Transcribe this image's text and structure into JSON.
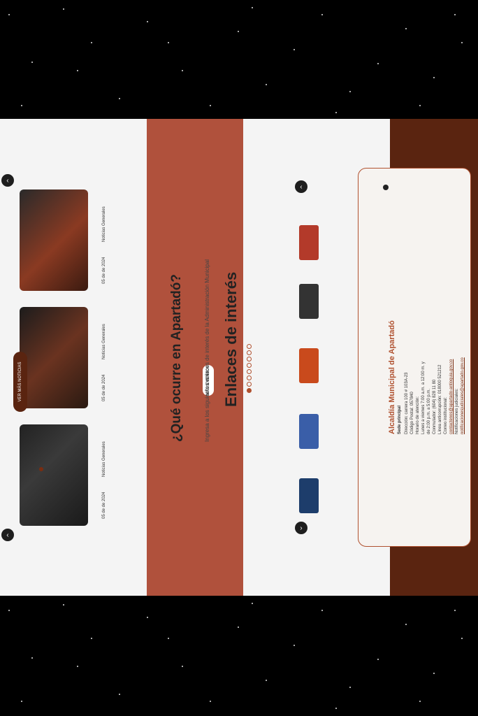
{
  "colors": {
    "brand_dark": "#5a2410",
    "brand_accent": "#b0512f",
    "events_bg": "#b0513c",
    "page_bg": "#f4f4f4"
  },
  "footer": {
    "title": "Alcaldía Municipal de Apartadó",
    "sede_label": "Sede principal",
    "address": "Dirección: carrera 100 # 103A-23",
    "postal": "Código Postal: 057840",
    "hours_label": "Horario de atención:",
    "hours_1": "Lunes a viernes 7:00 a.m. a 12:00 m. y",
    "hours_2": "de 2:00 p.m. a 5:00 p.m.",
    "phone": "Conmutador: (604) 828 11 80",
    "fax": "Línea anticorrupción: 018000 521212",
    "email_label": "Correo institucional:",
    "email": "contactenos@apartado-antioquia.gov.co",
    "notifications": "Notificaciones judiciales:",
    "notif_email": "notificacionesjudiciales@apartado.gov.co"
  },
  "enlaces": {
    "title": "Enlaces de interés",
    "subtitle": "Ingresa a los siguientes enlaces de interés de la Administración Municipal",
    "logos": [
      "gobierno-digital-logo",
      "sigep-logo",
      "transparencia-logo",
      "mintic-logo",
      "secop-logo"
    ],
    "prev": "‹",
    "next": "›"
  },
  "events": {
    "title": "¿Qué ocurre en Apartadó?",
    "button": "MÁS EVENTOS"
  },
  "news": {
    "button": "VER MÁS NOTICIAS",
    "items": [
      {
        "date": "05 de de 2024",
        "category": "Noticias Generales"
      },
      {
        "date": "05 de de 2024",
        "category": "Noticias Generales"
      },
      {
        "date": "05 de de 2024",
        "category": "Noticias Generales"
      }
    ]
  }
}
